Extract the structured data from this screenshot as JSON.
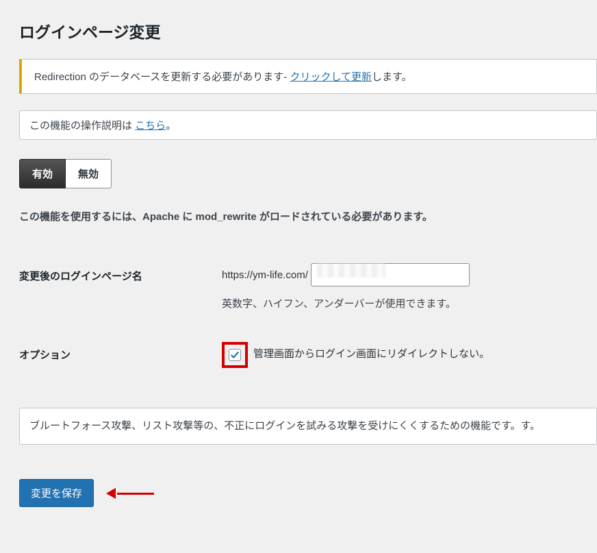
{
  "page": {
    "title": "ログインページ変更"
  },
  "notice": {
    "text_before": "Redirection のデータベースを更新する必要があります- ",
    "link": "クリックして更新",
    "text_after": "します。"
  },
  "help": {
    "text_before": "この機能の操作説明は ",
    "link": "こちら",
    "text_after": "。"
  },
  "toggle": {
    "enabled": "有効",
    "disabled": "無効"
  },
  "requirement": "この機能を使用するには、Apache に mod_rewrite がロードされている必要があります。",
  "login_page": {
    "label": "変更後のログインページ名",
    "url_prefix": "https://ym-life.com/",
    "input_value": "",
    "hint": "英数字、ハイフン、アンダーバーが使用できます。"
  },
  "option": {
    "label": "オプション",
    "checkbox_checked": true,
    "checkbox_label": "管理画面からログイン画面にリダイレクトしない。"
  },
  "description": "ブルートフォース攻撃、リスト攻撃等の、不正にログインを試みる攻撃を受けにくくするための機能です。す。",
  "submit": {
    "label": "変更を保存"
  }
}
